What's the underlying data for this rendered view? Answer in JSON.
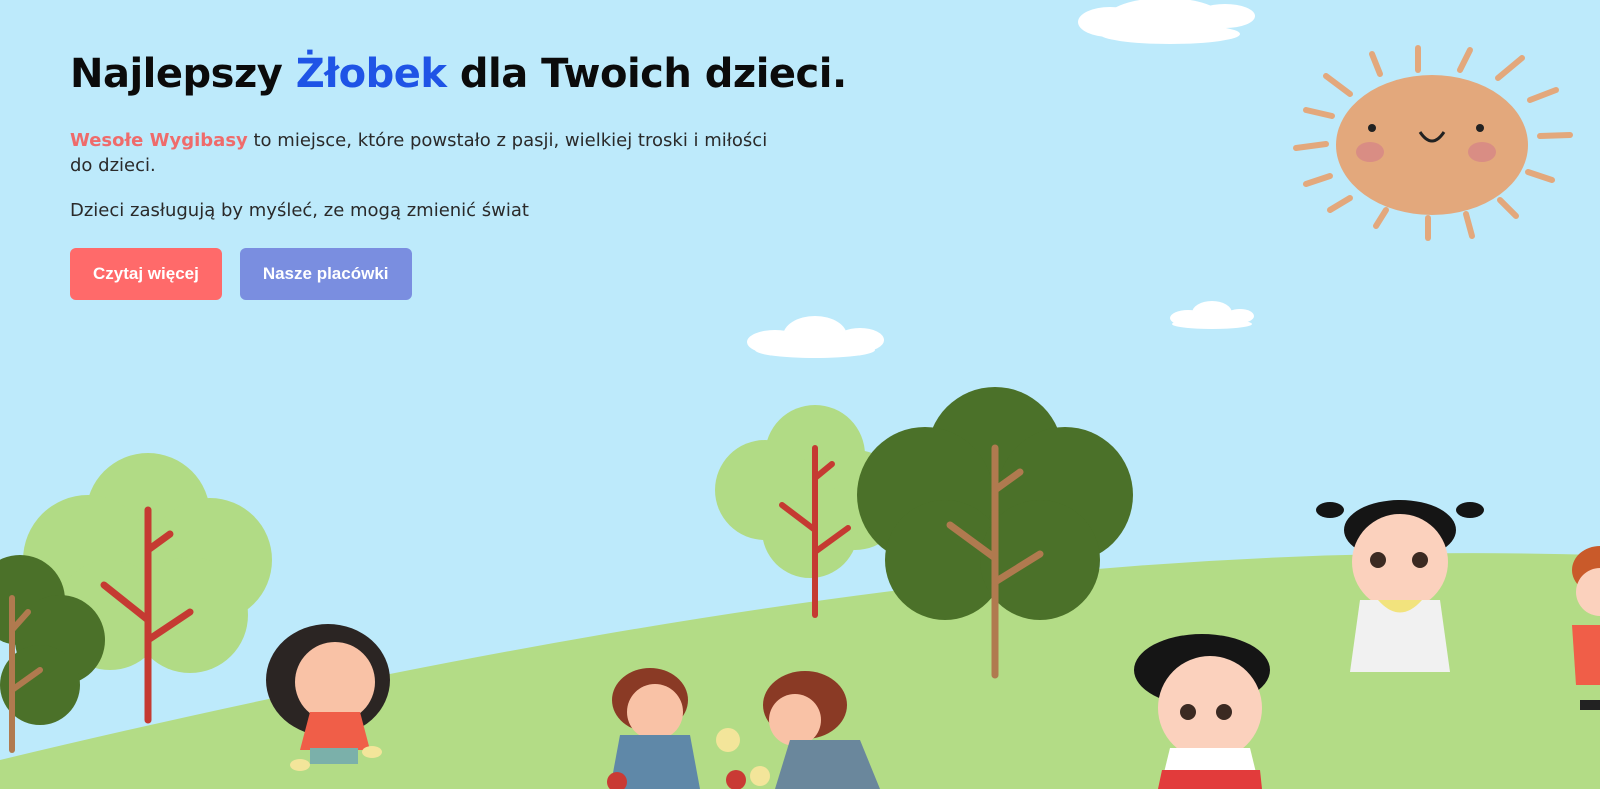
{
  "hero": {
    "title_before": "Najlepszy ",
    "title_accent": "Żłobek",
    "title_after": " dla Twoich dzieci.",
    "intro_brand": "Wesołe Wygibasy",
    "intro_text": " to miejsce, które powstało z pasji, wielkiej troski i miłości do dzieci.",
    "tagline": "Dzieci zasługują by myśleć, ze mogą zmienić świat",
    "read_more_label": "Czytaj więcej",
    "locations_label": "Nasze placówki"
  },
  "colors": {
    "sky": "#bdeafb",
    "hill": "#b3dc86",
    "title_accent": "#1f54e6",
    "brand": "#ef6b6b",
    "primary_button": "#ff6a6a",
    "secondary_button": "#7a8ee0",
    "sun": "#e3a87c"
  },
  "illustration": {
    "elements": [
      "sun-icon",
      "cloud-icon",
      "tree-icon",
      "child-icon"
    ]
  }
}
